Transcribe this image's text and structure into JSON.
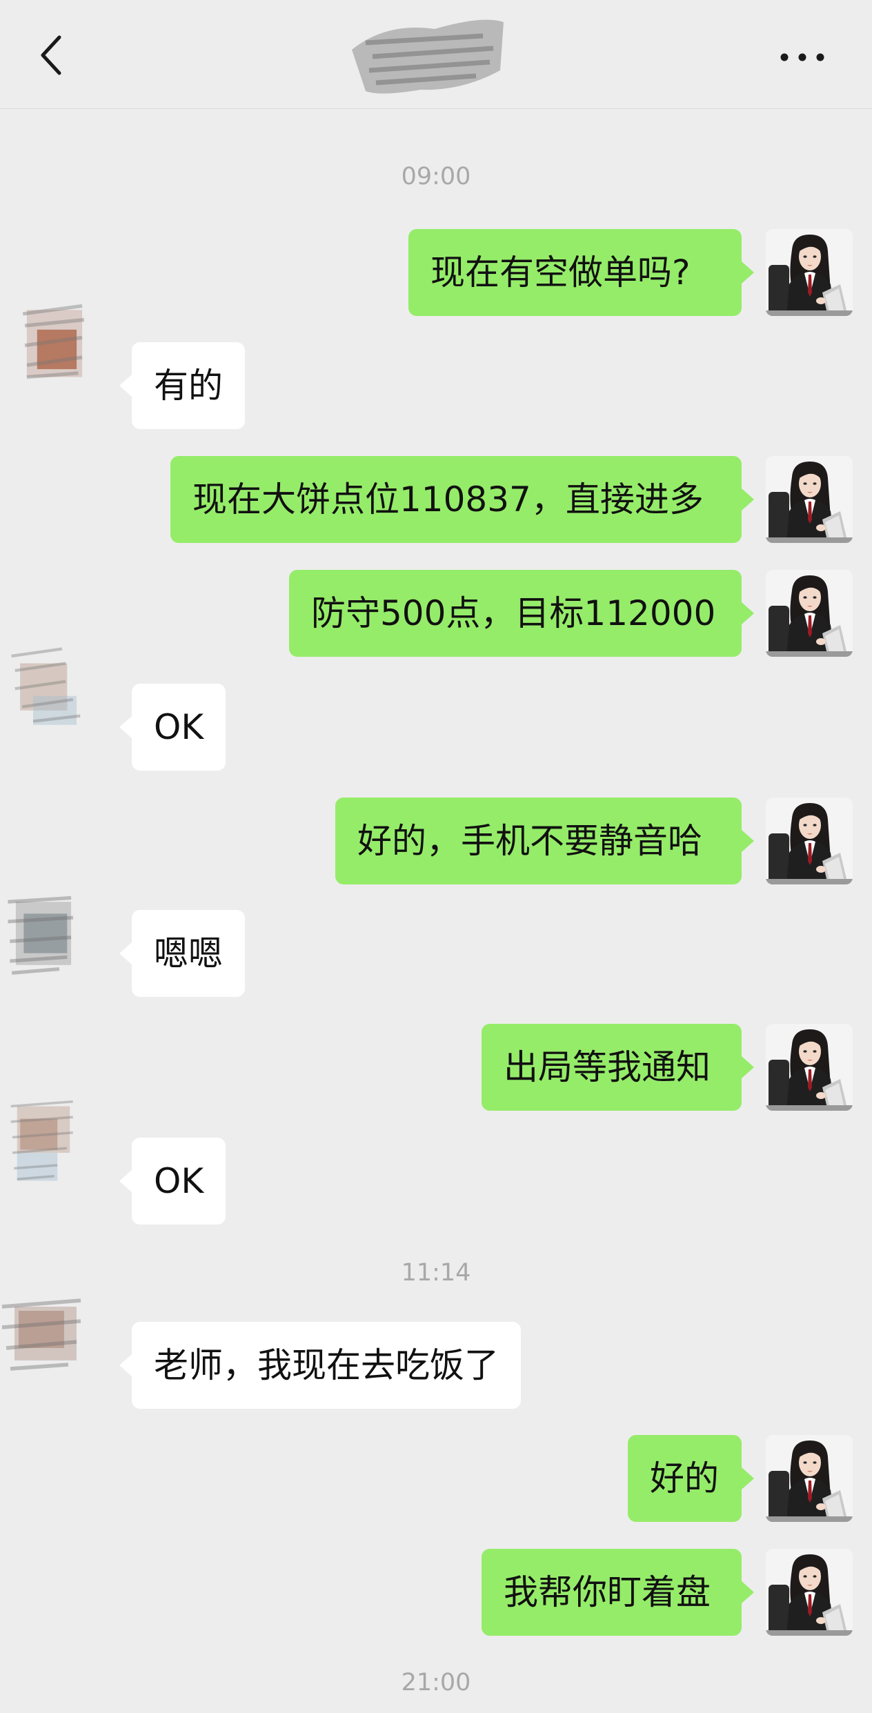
{
  "header": {
    "back_icon": "chevron-left-icon",
    "title": "",
    "more_icon": "more-dots-icon"
  },
  "colors": {
    "background": "#ededed",
    "outgoing_bubble": "#95ec69",
    "incoming_bubble": "#ffffff",
    "timestamp": "#a8a8a8"
  },
  "timestamps": [
    "09:00",
    "11:14",
    "21:00"
  ],
  "messages": [
    {
      "side": "out",
      "text": "现在有空做单吗?"
    },
    {
      "side": "in",
      "text": "有的"
    },
    {
      "side": "out",
      "text": "现在大饼点位110837，直接进多"
    },
    {
      "side": "out",
      "text": "防守500点，目标112000"
    },
    {
      "side": "in",
      "text": "OK"
    },
    {
      "side": "out",
      "text": "好的，手机不要静音哈"
    },
    {
      "side": "in",
      "text": "嗯嗯"
    },
    {
      "side": "out",
      "text": "出局等我通知"
    },
    {
      "side": "in",
      "text": "OK"
    },
    {
      "side": "in",
      "text": "老师，我现在去吃饭了"
    },
    {
      "side": "out",
      "text": "好的"
    },
    {
      "side": "out",
      "text": "我帮你盯着盘"
    }
  ]
}
